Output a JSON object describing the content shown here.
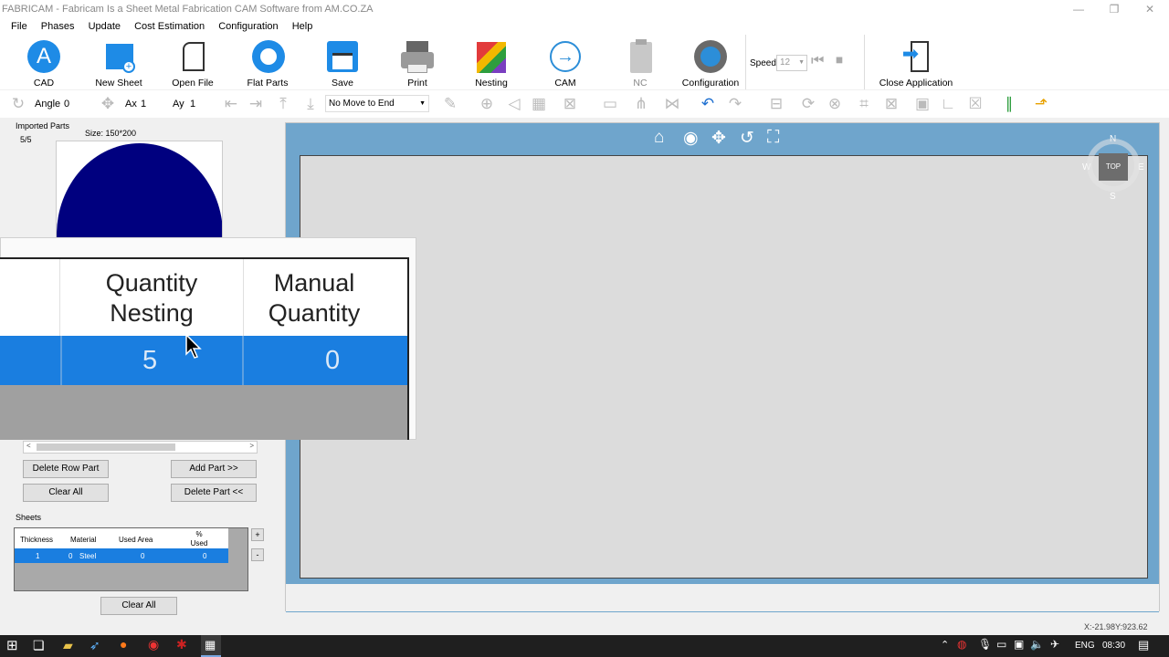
{
  "window": {
    "title": "FABRICAM - Fabricam Is a Sheet Metal Fabrication CAM Software from AM.CO.ZA",
    "minimize": "—",
    "maximize": "❐",
    "close": "✕"
  },
  "menu": [
    "File",
    "Phases",
    "Update",
    "Cost Estimation",
    "Configuration",
    "Help"
  ],
  "toolbar": {
    "cad": "CAD",
    "new_sheet": "New Sheet",
    "open_file": "Open File",
    "flat_parts": "Flat Parts",
    "save": "Save",
    "print": "Print",
    "nesting": "Nesting",
    "cam": "CAM",
    "nc": "NC",
    "configuration": "Configuration",
    "speed_label": "Speed",
    "speed_value": "12",
    "close_app": "Close Application"
  },
  "toolbar2": {
    "angle_label": "Angle",
    "angle_value": "0",
    "ax_label": "Ax",
    "ax_value": "1",
    "ay_label": "Ay",
    "ay_value": "1",
    "move_select": "No Move to End"
  },
  "imported": {
    "title": "Imported Parts",
    "count": "5/5",
    "size": "Size: 150*200",
    "shape_color": "#00007f"
  },
  "grid": {
    "headers": [
      "Quantity Nesting",
      "Manual Quantity"
    ],
    "row": [
      "5",
      "0"
    ],
    "select_color": "#1a7ee0"
  },
  "buttons": {
    "delete_row": "Delete Row Part",
    "add_part": "Add Part >>",
    "clear_all": "Clear All",
    "delete_part": "Delete Part <<",
    "clear_all_sheets": "Clear All"
  },
  "sheets": {
    "title": "Sheets",
    "headers": [
      "Thickness",
      "Material",
      "Used Area",
      "% Used"
    ],
    "row": [
      "1",
      "0",
      "Steel",
      "0",
      "0"
    ],
    "plus": "+",
    "minus": "-"
  },
  "compass": {
    "n": "N",
    "s": "S",
    "e": "E",
    "w": "W",
    "top": "TOP"
  },
  "status": {
    "coords": "X:-21.98Y:923.62"
  },
  "taskbar": {
    "lang": "ENG",
    "time": "08:30"
  }
}
